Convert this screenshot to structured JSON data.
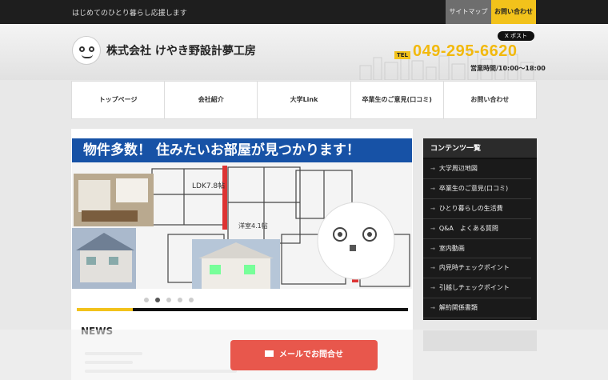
{
  "topbar": {
    "tagline": "はじめてのひとり暮らし応援します",
    "sitemap": "サイトマップ",
    "contact": "お問い合わせ"
  },
  "header": {
    "company": "株式会社 けやき野設計夢工房",
    "post": "X ポスト",
    "tel_label": "TEL",
    "tel": "049-295-6620",
    "hours": "営業時間/10:00～18:00"
  },
  "nav": {
    "items": [
      "トップページ",
      "会社紹介",
      "大学Link",
      "卒業生のご意見(口コミ)",
      "お問い合わせ"
    ]
  },
  "slider": {
    "banner": "物件多数！ 住みたいお部屋が見つかります！",
    "active_slide": 2,
    "slide_count": 5
  },
  "news": {
    "title": "NEWS"
  },
  "sidebar": {
    "title": "コンテンツ一覧",
    "items": [
      "大学周辺地図",
      "卒業生のご意見(口コミ)",
      "ひとり暮らしの生活費",
      "Q&A　よくある質問",
      "室内動画",
      "内見時チェックポイント",
      "引越しチェックポイント",
      "解約関係書類"
    ]
  },
  "mail_button": {
    "label": "メールでお問合せ"
  },
  "colors": {
    "accent": "#f2c21b",
    "banner": "#1752a6",
    "mail": "#e8574c"
  }
}
